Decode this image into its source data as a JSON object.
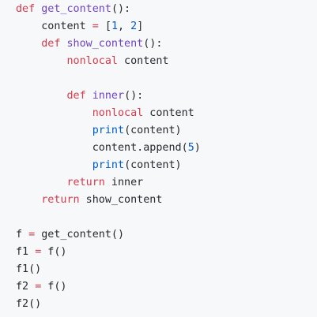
{
  "colors": {
    "background": "#f6f8fa",
    "text": "#24292e",
    "keyword": "#d73a49",
    "function_name": "#6f42c1",
    "number": "#005cc5",
    "builtin": "#005cc5"
  },
  "code": {
    "language": "python",
    "lines": [
      {
        "indent": 0,
        "tokens": [
          {
            "t": "kw",
            "v": "def"
          },
          {
            "t": "plain",
            "v": " "
          },
          {
            "t": "fn",
            "v": "get_content"
          },
          {
            "t": "plain",
            "v": "():"
          }
        ]
      },
      {
        "indent": 4,
        "tokens": [
          {
            "t": "plain",
            "v": "content "
          },
          {
            "t": "op",
            "v": "="
          },
          {
            "t": "plain",
            "v": " ["
          },
          {
            "t": "num",
            "v": "1"
          },
          {
            "t": "plain",
            "v": ", "
          },
          {
            "t": "num",
            "v": "2"
          },
          {
            "t": "plain",
            "v": "]"
          }
        ]
      },
      {
        "indent": 4,
        "tokens": [
          {
            "t": "kw",
            "v": "def"
          },
          {
            "t": "plain",
            "v": " "
          },
          {
            "t": "fn",
            "v": "show_content"
          },
          {
            "t": "plain",
            "v": "():"
          }
        ]
      },
      {
        "indent": 8,
        "tokens": [
          {
            "t": "kw",
            "v": "nonlocal"
          },
          {
            "t": "plain",
            "v": " content"
          }
        ]
      },
      {
        "indent": 0,
        "tokens": []
      },
      {
        "indent": 8,
        "tokens": [
          {
            "t": "kw",
            "v": "def"
          },
          {
            "t": "plain",
            "v": " "
          },
          {
            "t": "fn",
            "v": "inner"
          },
          {
            "t": "plain",
            "v": "():"
          }
        ]
      },
      {
        "indent": 12,
        "tokens": [
          {
            "t": "kw",
            "v": "nonlocal"
          },
          {
            "t": "plain",
            "v": " content"
          }
        ]
      },
      {
        "indent": 12,
        "tokens": [
          {
            "t": "bi",
            "v": "print"
          },
          {
            "t": "plain",
            "v": "(content)"
          }
        ]
      },
      {
        "indent": 12,
        "tokens": [
          {
            "t": "plain",
            "v": "content.append("
          },
          {
            "t": "num",
            "v": "5"
          },
          {
            "t": "plain",
            "v": ")"
          }
        ]
      },
      {
        "indent": 12,
        "tokens": [
          {
            "t": "bi",
            "v": "print"
          },
          {
            "t": "plain",
            "v": "(content)"
          }
        ]
      },
      {
        "indent": 8,
        "tokens": [
          {
            "t": "kw",
            "v": "return"
          },
          {
            "t": "plain",
            "v": " inner"
          }
        ]
      },
      {
        "indent": 4,
        "tokens": [
          {
            "t": "kw",
            "v": "return"
          },
          {
            "t": "plain",
            "v": " show_content"
          }
        ]
      },
      {
        "indent": 0,
        "tokens": []
      },
      {
        "indent": 0,
        "tokens": [
          {
            "t": "plain",
            "v": "f "
          },
          {
            "t": "op",
            "v": "="
          },
          {
            "t": "plain",
            "v": " get_content()"
          }
        ]
      },
      {
        "indent": 0,
        "tokens": [
          {
            "t": "plain",
            "v": "f1 "
          },
          {
            "t": "op",
            "v": "="
          },
          {
            "t": "plain",
            "v": " f()"
          }
        ]
      },
      {
        "indent": 0,
        "tokens": [
          {
            "t": "plain",
            "v": "f1()"
          }
        ]
      },
      {
        "indent": 0,
        "tokens": [
          {
            "t": "plain",
            "v": "f2 "
          },
          {
            "t": "op",
            "v": "="
          },
          {
            "t": "plain",
            "v": " f()"
          }
        ]
      },
      {
        "indent": 0,
        "tokens": [
          {
            "t": "plain",
            "v": "f2()"
          }
        ]
      }
    ]
  }
}
